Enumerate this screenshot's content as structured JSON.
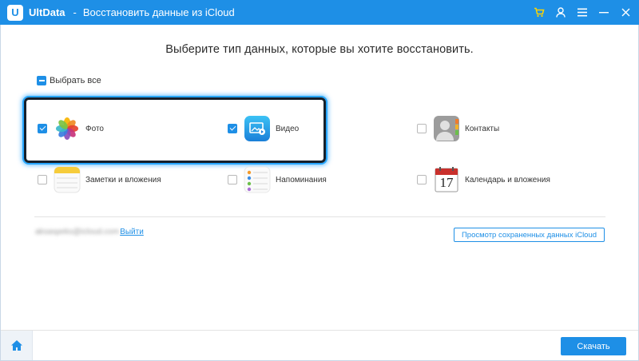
{
  "titlebar": {
    "logo_letter": "U",
    "app_name": "UltData",
    "separator": "-",
    "page_name": "Восстановить данные из iCloud",
    "icons": [
      "cart-icon",
      "user-icon",
      "menu-icon",
      "minimize-icon",
      "close-icon"
    ],
    "cart_color": "#ffd400"
  },
  "heading": "Выберите тип данных, которые вы хотите восстановить.",
  "select_all": {
    "label": "Выбрать все",
    "state": "partial"
  },
  "items": [
    {
      "label": "Фото",
      "checked": true,
      "icon": "photos-icon"
    },
    {
      "label": "Видео",
      "checked": true,
      "icon": "video-icon"
    },
    {
      "label": "Контакты",
      "checked": false,
      "icon": "contacts-icon"
    },
    {
      "label": "Заметки и вложения",
      "checked": false,
      "icon": "notes-icon"
    },
    {
      "label": "Напоминания",
      "checked": false,
      "icon": "reminders-icon"
    },
    {
      "label": "Календарь и вложения",
      "checked": false,
      "icon": "calendar-icon"
    }
  ],
  "calendar_day": "17",
  "account": {
    "email": "aksaspeks@icloud.com",
    "logout": "Выйти"
  },
  "view_saved_button": "Просмотр сохраненных данных iCloud",
  "download_button": "Скачать",
  "colors": {
    "accent": "#1e8fe6",
    "highlight": "#28a7ff"
  }
}
